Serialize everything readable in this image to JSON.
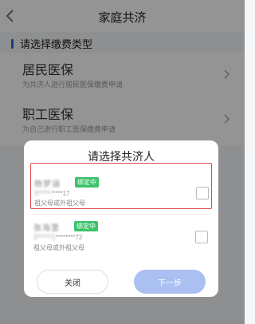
{
  "navbar": {
    "title": "家庭共济"
  },
  "section": {
    "title": "请选择缴费类型"
  },
  "options": [
    {
      "title": "居民医保",
      "desc": "为共济人进行居民医保缴费申请"
    },
    {
      "title": "职工医保",
      "desc": "为自己进行职工医保缴费申请"
    }
  ],
  "modal": {
    "title": "请选择共济人",
    "persons": [
      {
        "name": "杨梦涵",
        "badge": "绑定中",
        "id_masked": "3******",
        "id_suffix": "****17",
        "relation": "祖父母或外祖父母"
      },
      {
        "name": "张海里",
        "badge": "绑定中",
        "id_masked": "3******1",
        "id_suffix": "********72",
        "relation": "祖父母或外祖父母"
      }
    ],
    "close_label": "关闭",
    "next_label": "下一步"
  },
  "colors": {
    "accent": "#2f6bd8",
    "badge_green": "#3cc26a",
    "next_disabled": "#aac0f0",
    "highlight_border": "#e04848"
  }
}
